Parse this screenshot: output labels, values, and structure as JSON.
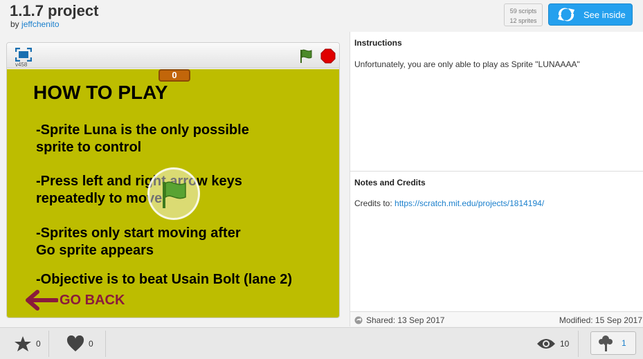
{
  "header": {
    "title": "1.1.7 project",
    "by_label": "by",
    "author": "jeffchenito",
    "scripts": "59 scripts",
    "sprites": "12 sprites",
    "see_inside": "See inside"
  },
  "player": {
    "version": "v458",
    "counter": "0",
    "stage": {
      "heading": "HOW TO PLAY",
      "line1": "-Sprite Luna is the only possible",
      "line2": "sprite to control",
      "line3": "-Press left and right arrow keys",
      "line4": "repeatedly to move",
      "line5": "-Sprites only start moving after",
      "line6": "Go sprite appears",
      "line7": "-Objective is to beat Usain Bolt (lane 2)",
      "go_back": "GO BACK"
    },
    "stage_color": "#bdbd00"
  },
  "instructions": {
    "title": "Instructions",
    "text": "Unfortunately, you are only able to play as Sprite \"LUNAAAA\""
  },
  "notes": {
    "title": "Notes and Credits",
    "prefix": "Credits to:",
    "link": "https://scratch.mit.edu/projects/1814194/"
  },
  "meta": {
    "shared": "Shared: 13 Sep 2017",
    "modified": "Modified: 15 Sep 2017"
  },
  "footer": {
    "favorites": "0",
    "loves": "0",
    "views": "10",
    "remixes": "1"
  },
  "colors": {
    "accent": "#24a0ee",
    "link": "#1a7fcc"
  }
}
